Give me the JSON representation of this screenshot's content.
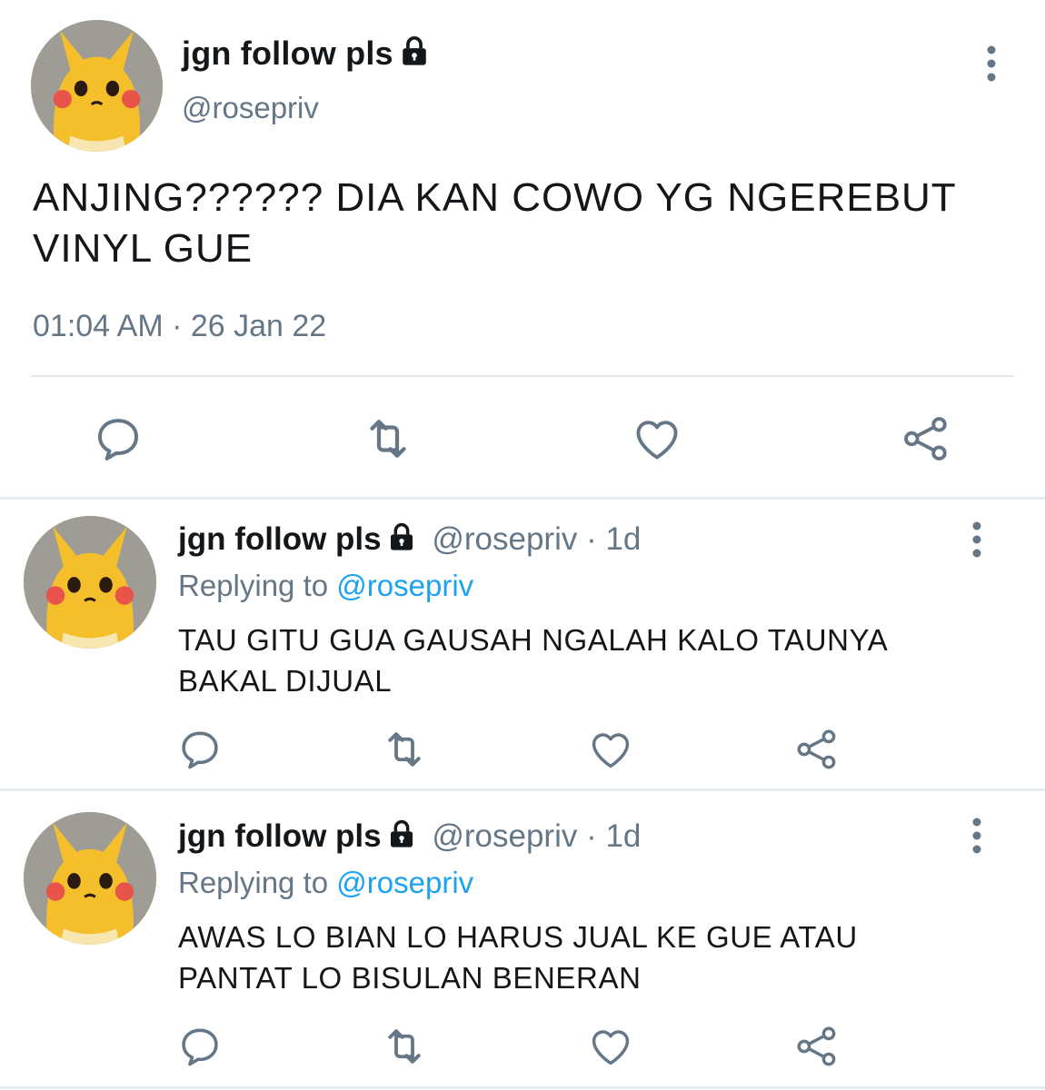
{
  "main_tweet": {
    "display_name": "jgn follow pls",
    "handle": "@rosepriv",
    "text": "ANJING?????? DIA KAN COWO YG NGEREBUT VINYL GUE",
    "timestamp": "01:04 AM · 26 Jan 22",
    "actions": [
      "reply-icon",
      "retweet-icon",
      "like-icon",
      "share-icon"
    ]
  },
  "replies": [
    {
      "display_name": "jgn follow pls",
      "handle": "@rosepriv",
      "dot": "·",
      "time": "1d",
      "replying_label": "Replying to",
      "replying_to": "@rosepriv",
      "text": "TAU GITU GUA GAUSAH NGALAH KALO TAUNYA BAKAL DIJUAL"
    },
    {
      "display_name": "jgn follow pls",
      "handle": "@rosepriv",
      "dot": "·",
      "time": "1d",
      "replying_label": "Replying to",
      "replying_to": "@rosepriv",
      "text": "AWAS LO BIAN LO HARUS JUAL KE GUE ATAU PANTAT LO BISULAN BENERAN"
    }
  ],
  "colors": {
    "text": "#14171a",
    "secondary": "#657786",
    "accent": "#1da1f2",
    "divider": "#e6ecf0",
    "icon": "#657786"
  }
}
